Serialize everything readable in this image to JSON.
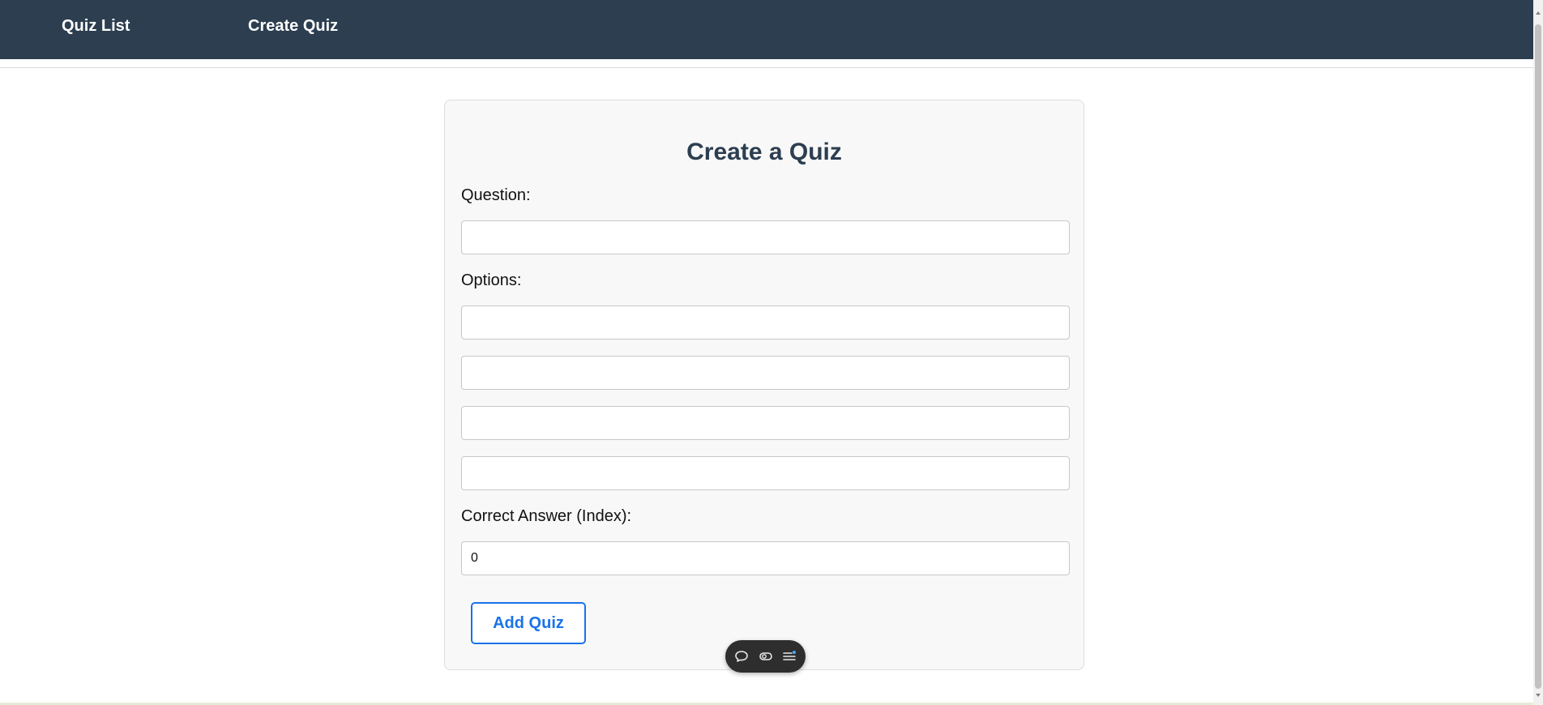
{
  "nav": {
    "links": [
      {
        "label": "Quiz List"
      },
      {
        "label": "Create Quiz"
      }
    ],
    "background_color": "#2c3e50"
  },
  "form": {
    "title": "Create a Quiz",
    "question_label": "Question:",
    "question_value": "",
    "options_label": "Options:",
    "options": [
      "",
      "",
      "",
      ""
    ],
    "correct_answer_label": "Correct Answer (Index):",
    "correct_answer_value": "0",
    "submit_label": "Add Quiz",
    "accent_color": "#1a73e8"
  },
  "toolbar": {
    "icons": [
      "chat-bubble-icon",
      "toggle-icon",
      "menu-list-icon"
    ]
  }
}
